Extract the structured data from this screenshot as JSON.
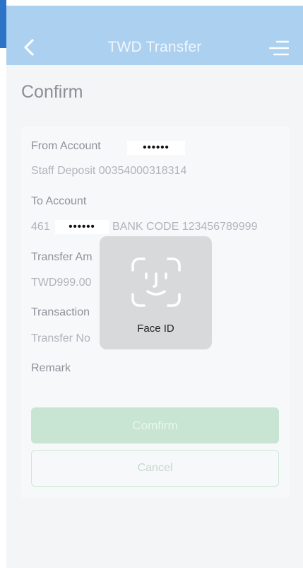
{
  "header": {
    "title": "TWD Transfer",
    "back_icon": "chevron-left-icon",
    "menu_icon": "menu-icon"
  },
  "page": {
    "title": "Confirm"
  },
  "form": {
    "from_account": {
      "label": "From Account",
      "masked": "••••••",
      "value": "Staff Deposit 00354000318314"
    },
    "to_account": {
      "label": "To Account",
      "prefix": "461",
      "masked": "••••••",
      "value": "BANK CODE 123456789999"
    },
    "transfer_amount": {
      "label": "Transfer Am",
      "value": "TWD999.00"
    },
    "transaction": {
      "label": "Transaction",
      "value": "Transfer No"
    },
    "remark": {
      "label": "Remark"
    }
  },
  "buttons": {
    "confirm_label": "Comfirm",
    "cancel_label": "Cancel"
  },
  "faceid": {
    "label": "Face ID",
    "icon": "face-id-icon"
  },
  "colors": {
    "navbar": "#a6cdef",
    "confirm_button": "#c7e5d2",
    "cancel_border": "#cde9d6",
    "edge_strip": "#2d74c9"
  }
}
